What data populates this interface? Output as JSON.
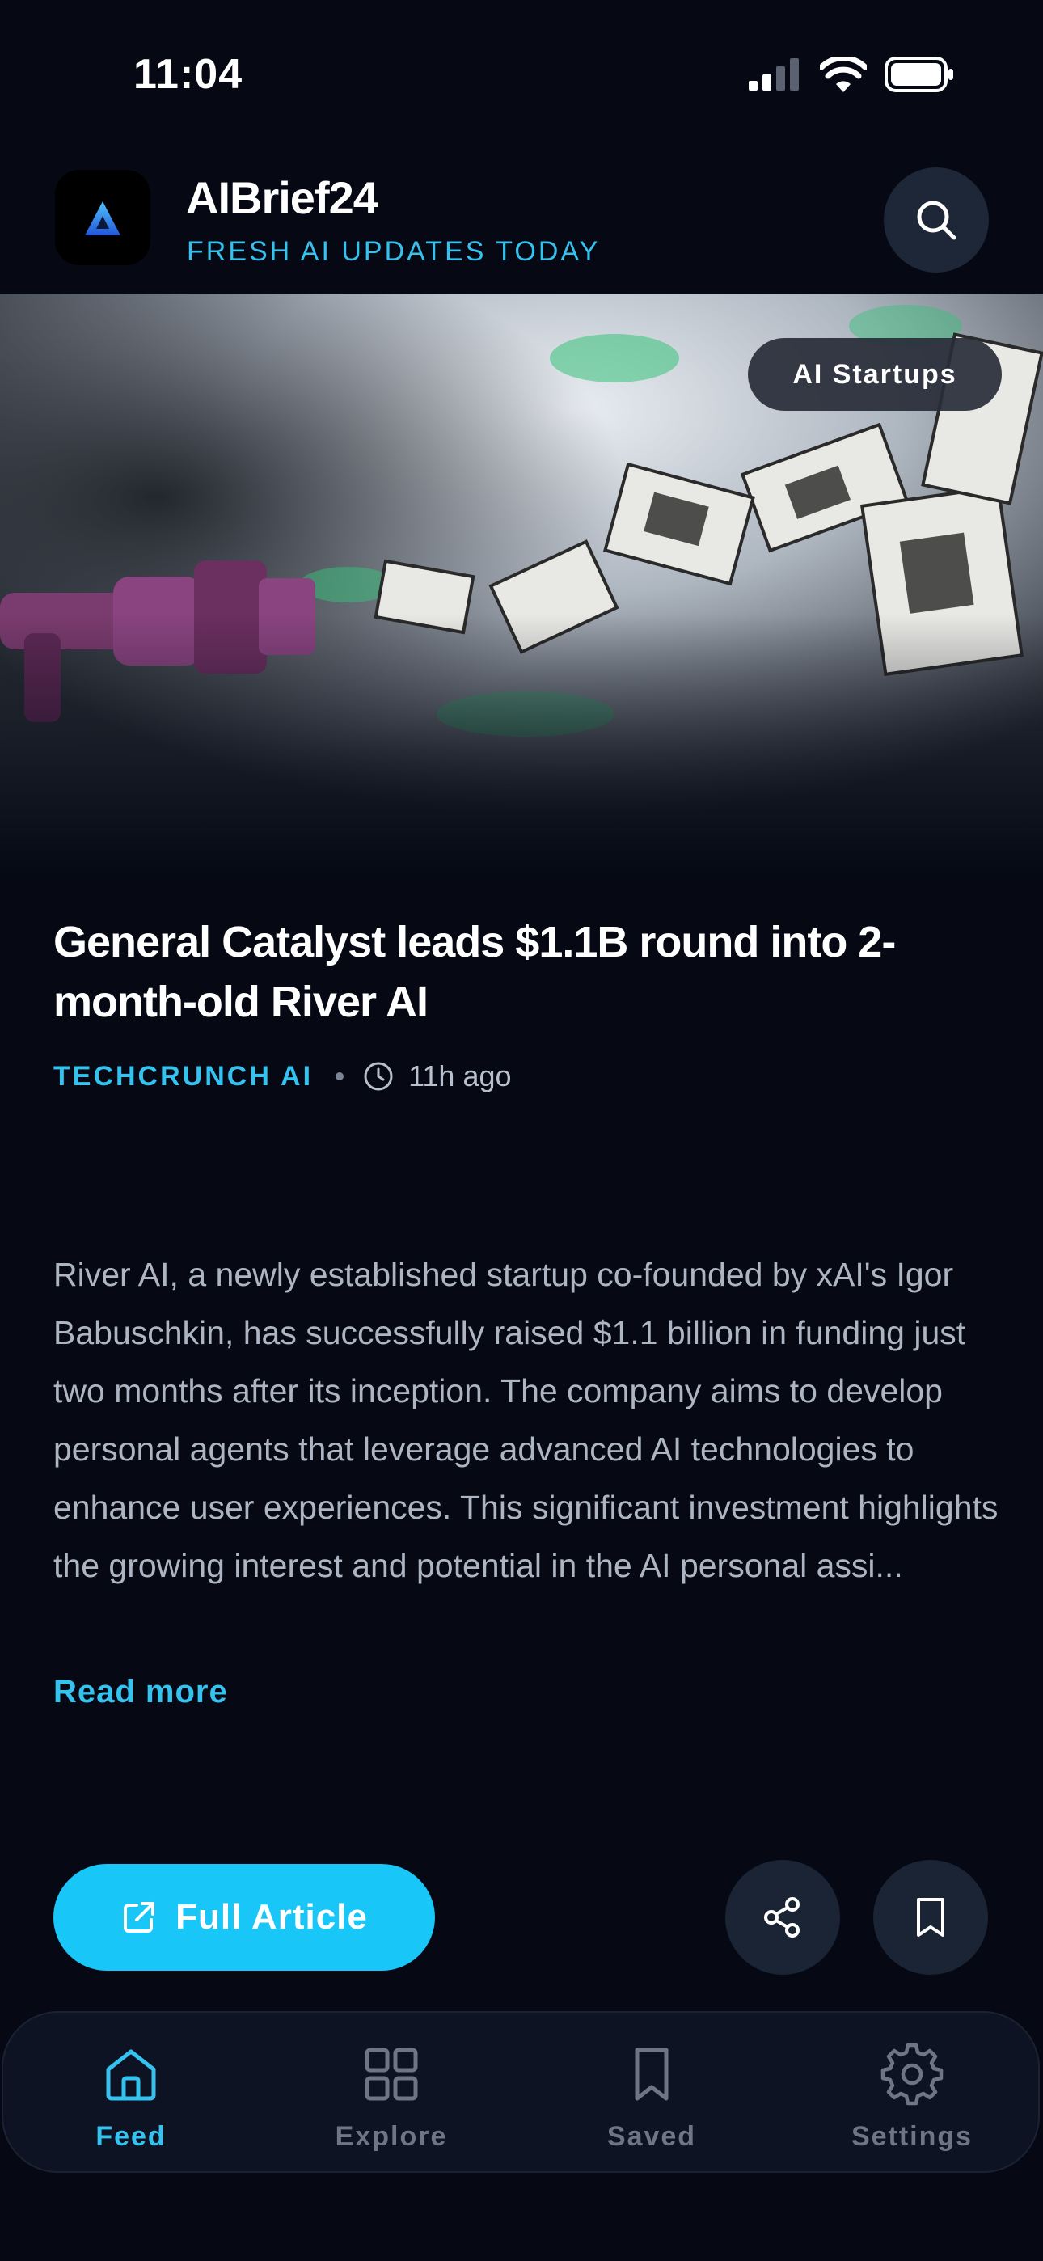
{
  "status_bar": {
    "time": "11:04"
  },
  "header": {
    "title": "AIBrief24",
    "tagline": "FRESH AI UPDATES TODAY"
  },
  "article": {
    "category": "AI Startups",
    "headline": "General Catalyst leads $1.1B round into 2-month-old River AI",
    "source": "TECHCRUNCH AI",
    "time_ago": "11h ago",
    "summary": "River AI, a newly established startup co-founded by xAI's Igor Babuschkin, has successfully raised $1.1 billion in funding just two months after its inception. The company aims to develop personal agents that leverage advanced AI technologies to enhance user experiences. This significant investment highlights the growing interest and potential in the AI personal assi...",
    "read_more": "Read more",
    "full_article_label": "Full Article"
  },
  "nav": {
    "items": [
      {
        "label": "Feed",
        "icon": "home-icon",
        "active": true
      },
      {
        "label": "Explore",
        "icon": "grid-icon",
        "active": false
      },
      {
        "label": "Saved",
        "icon": "bookmark-icon",
        "active": false
      },
      {
        "label": "Settings",
        "icon": "gear-icon",
        "active": false
      }
    ]
  },
  "colors": {
    "background": "#060914",
    "accent": "#35c2ef",
    "button": "#18c6f7",
    "surface": "#1b2434"
  }
}
